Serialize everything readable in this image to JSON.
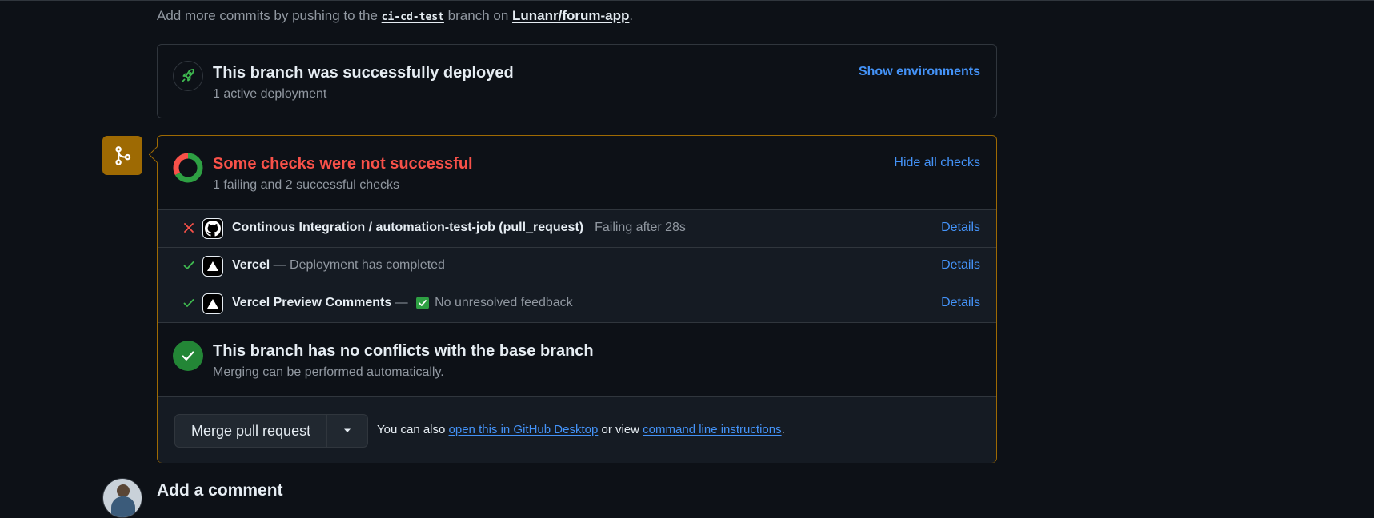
{
  "commit_hint": {
    "prefix": "Add more commits by pushing to the",
    "branch": "ci-cd-test",
    "middle": "branch on",
    "repo": "Lunanr/forum-app",
    "suffix": "."
  },
  "deployment": {
    "icon": "rocket-icon",
    "title": "This branch was successfully deployed",
    "subtitle": "1 active deployment",
    "action": "Show environments"
  },
  "merge_badge_icon": "git-merge-icon",
  "checks": {
    "title": "Some checks were not successful",
    "subtitle": "1 failing and 2 successful checks",
    "action": "Hide all checks",
    "summary": {
      "failing": 1,
      "successful": 2
    },
    "colors": {
      "fail": "#f85149",
      "success": "#2ea043"
    },
    "items": [
      {
        "status": "failing",
        "status_icon": "x-icon",
        "app_icon": "github-icon",
        "name": "Continous Integration / automation-test-job (pull_request)",
        "separator": "",
        "description": "Failing after 28s",
        "link": "Details"
      },
      {
        "status": "success",
        "status_icon": "check-icon",
        "app_icon": "vercel-icon",
        "name": "Vercel",
        "separator": " — ",
        "description": "Deployment has completed",
        "link": "Details"
      },
      {
        "status": "success",
        "status_icon": "check-icon",
        "app_icon": "vercel-icon",
        "name": "Vercel Preview Comments",
        "separator": " — ",
        "description": "No unresolved feedback",
        "link": "Details"
      }
    ]
  },
  "conflicts": {
    "title": "This branch has no conflicts with the base branch",
    "subtitle": "Merging can be performed automatically."
  },
  "merge": {
    "button": "Merge pull request",
    "text_prefix": "You can also",
    "desktop_link": "open this in GitHub Desktop",
    "text_middle": "or view",
    "cli_link": "command line instructions",
    "text_suffix": "."
  },
  "comment": {
    "title": "Add a comment"
  }
}
